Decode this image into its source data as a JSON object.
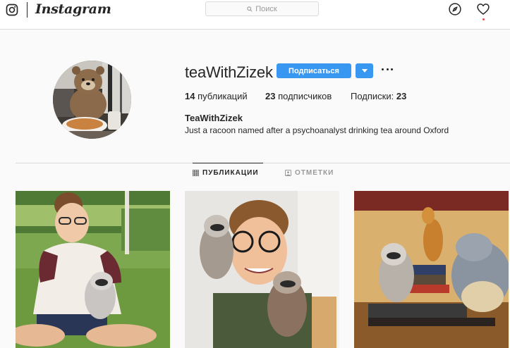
{
  "header": {
    "brand": "Instagram",
    "search_placeholder": "Поиск"
  },
  "profile": {
    "username": "teaWithZizek",
    "follow_label": "Подписаться",
    "stats": {
      "posts_count": "14",
      "posts_label": " публикаций",
      "followers_count": "23",
      "followers_label": " подписчиков",
      "following_label": "Подписки: ",
      "following_count": "23"
    },
    "full_name": "TeaWithZizek",
    "bio": "Just a racoon named after a psychoanalyst drinking tea around Oxford"
  },
  "tabs": [
    {
      "label": "ПУБЛИКАЦИИ",
      "active": true
    },
    {
      "label": "ОТМЕТКИ",
      "active": false
    }
  ],
  "colors": {
    "accent": "#3897f0",
    "notification": "#ed4956",
    "text": "#262626",
    "muted": "#999999"
  },
  "icons": [
    "instagram-glyph-icon",
    "search-icon",
    "explore-compass-icon",
    "heart-icon",
    "chevron-down-icon",
    "more-dots-icon",
    "grid-icon",
    "tagged-icon"
  ]
}
